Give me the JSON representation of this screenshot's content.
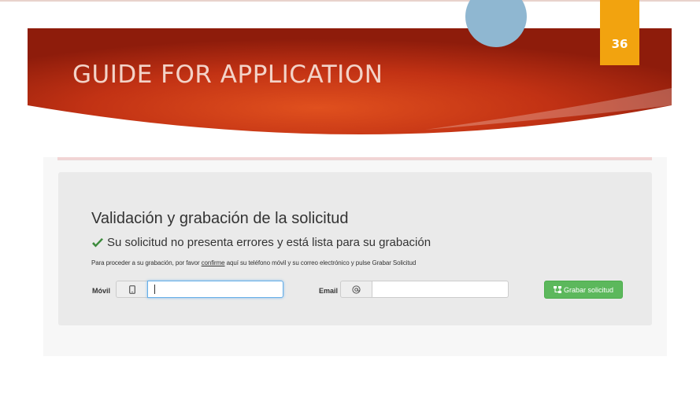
{
  "slide": {
    "title": "GUIDE FOR APPLICATION",
    "page_number": "36",
    "colors": {
      "banner": "#c8391a",
      "circle": "#8fb7d1",
      "tab": "#f2a30f"
    }
  },
  "form": {
    "heading": "Validación y grabación de la solicitud",
    "status": "Su solicitud no presenta errores y está lista para su grabación",
    "info_before": "Para proceder a su grabación, por favor ",
    "info_link": "confirme",
    "info_after": " aquí su teléfono móvil y su correo electrónico y pulse Grabar Solicitud",
    "movil_label": "Móvil",
    "movil_value": "",
    "email_label": "Email",
    "email_value": "",
    "save_label": "Grabar solicitud",
    "icons": {
      "status": "checkmark-icon",
      "movil": "mobile-phone-icon",
      "email": "at-sign-icon",
      "save": "save-sitemap-icon"
    },
    "colors": {
      "success": "#5cb85c",
      "check": "#3c8b3c",
      "focus": "#66afe9"
    }
  }
}
